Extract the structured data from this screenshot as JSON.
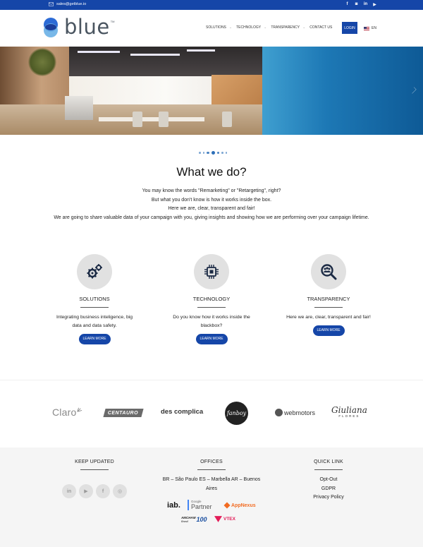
{
  "topbar": {
    "email": "sales@getblue.io",
    "social": [
      "f",
      "◙",
      "in",
      "▶"
    ]
  },
  "header": {
    "logo_text": "blue",
    "logo_tm": "TM",
    "nav": [
      "SOLUTIONS",
      "TECHNOLOGY",
      "TRANSPARENCY",
      "CONTACT US"
    ],
    "login": "LOGIN",
    "lang": "EN"
  },
  "colors": {
    "brand_blue": "#1546a8",
    "footer_bg": "#f5f5f5",
    "icon_circle": "#e1e1e1"
  },
  "slider": {
    "dot_count": 7,
    "active_index": 3
  },
  "what_we_do": {
    "title": "What we do?",
    "lines": [
      "You may know the words \"Remarketing\" or \"Retargeting\", right?",
      "But what you don't know is how it works inside the box.",
      "Here we are, clear, transparent and fair!",
      "We are going to share valuable data of your campaign with you, giving insights and showing how we are performing over your campaign lifetime."
    ]
  },
  "features": [
    {
      "icon": "gears-icon",
      "title": "SOLUTIONS",
      "desc": "Integrating business inteligence, big data and data safety.",
      "button": "LEARN MORE"
    },
    {
      "icon": "chip-icon",
      "title": "TECHNOLOGY",
      "desc": "Do you know how it works inside the blackbox?",
      "button": "LEARN MORE"
    },
    {
      "icon": "magnifier-people-icon",
      "title": "TRANSPARENCY",
      "desc": "Here we are, clear, transparent and fair!",
      "button": "LEARN MORE"
    }
  ],
  "clients": [
    "Claro",
    "CENTAURO",
    "des complica",
    "fanboy",
    "webmotors",
    "Giuliana",
    "FLORES"
  ],
  "footer": {
    "keep_updated": "KEEP UPDATED",
    "keep_social": [
      "in",
      "▶",
      "f",
      "◎"
    ],
    "offices_title": "OFFICES",
    "offices_text": "BR – São Paulo ES – Marbella AR – Buenos Aires",
    "quick_title": "QUICK LINK",
    "links": [
      "Opt-Out",
      "GDPR",
      "Privacy Policy"
    ],
    "partners": [
      "iab.",
      "Google",
      "Partner",
      "AppNexus",
      "AMCHAM",
      "Brasil",
      "100",
      "VTEX"
    ]
  }
}
